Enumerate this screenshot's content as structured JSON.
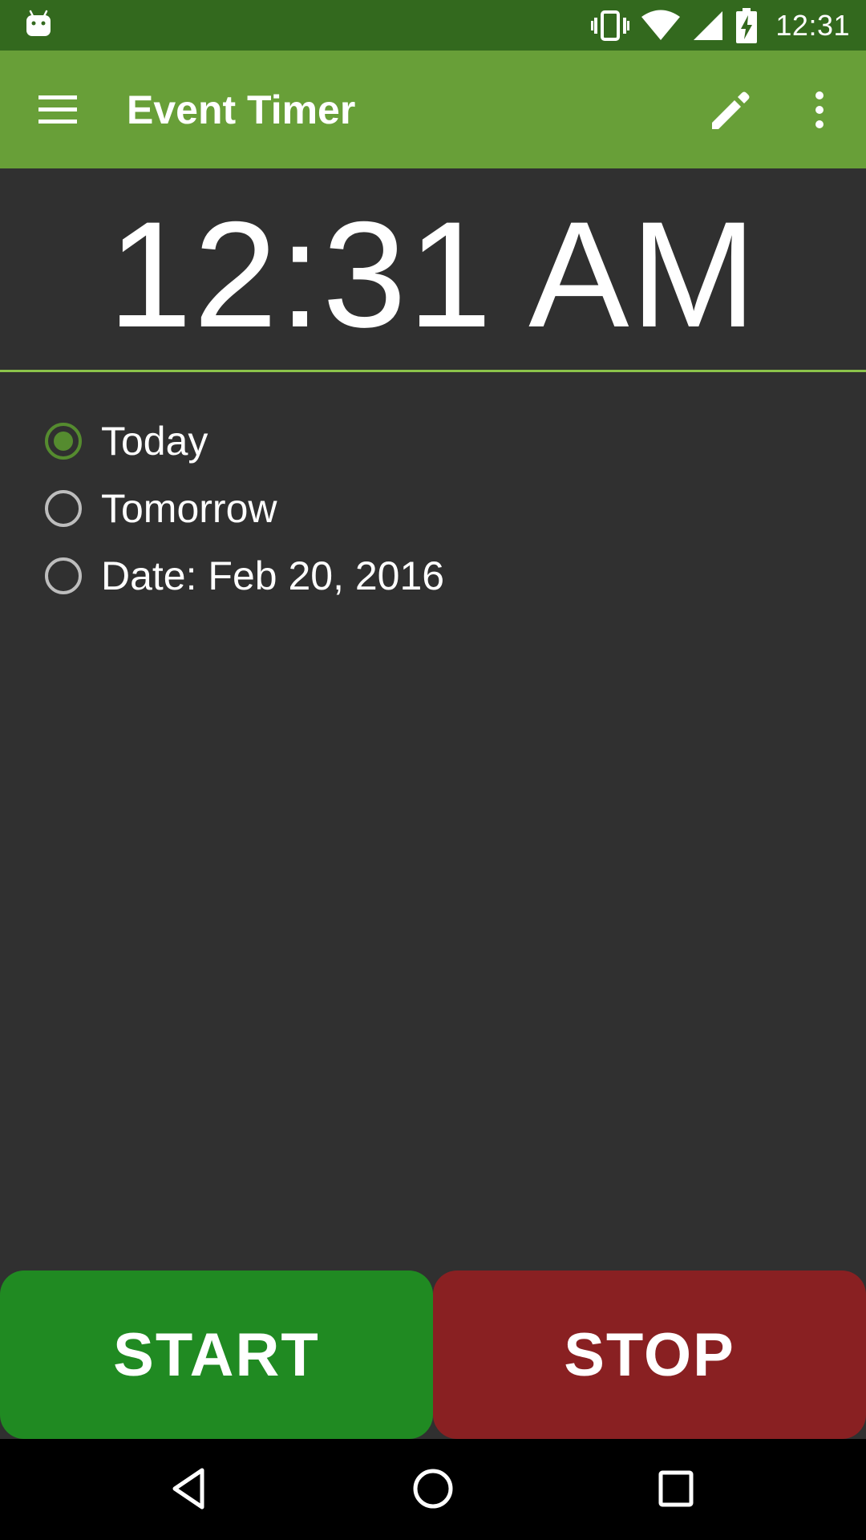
{
  "status_bar": {
    "time": "12:31",
    "icons": [
      "android-icon",
      "vibrate-icon",
      "wifi-icon",
      "signal-icon",
      "battery-charging-icon"
    ]
  },
  "app_bar": {
    "title": "Event Timer",
    "icons": [
      "menu-icon",
      "edit-icon",
      "overflow-menu-icon"
    ]
  },
  "time_display": {
    "value": "12:31 AM"
  },
  "date_options": {
    "selected": "Today",
    "items": [
      {
        "label": "Today",
        "checked": true
      },
      {
        "label": "Tomorrow",
        "checked": false
      },
      {
        "label": "Date: Feb 20, 2016",
        "checked": false
      }
    ]
  },
  "buttons": {
    "start_label": "START",
    "stop_label": "STOP"
  },
  "nav_bar": {
    "icons": [
      "back-icon",
      "home-icon",
      "recents-icon"
    ]
  },
  "colors": {
    "status_bar": "#33691e",
    "app_bar": "#689f38",
    "background": "#303030",
    "divider": "#8bc34a",
    "radio_checked": "#558b2f",
    "start_button": "#208a22",
    "stop_button": "#892022"
  }
}
